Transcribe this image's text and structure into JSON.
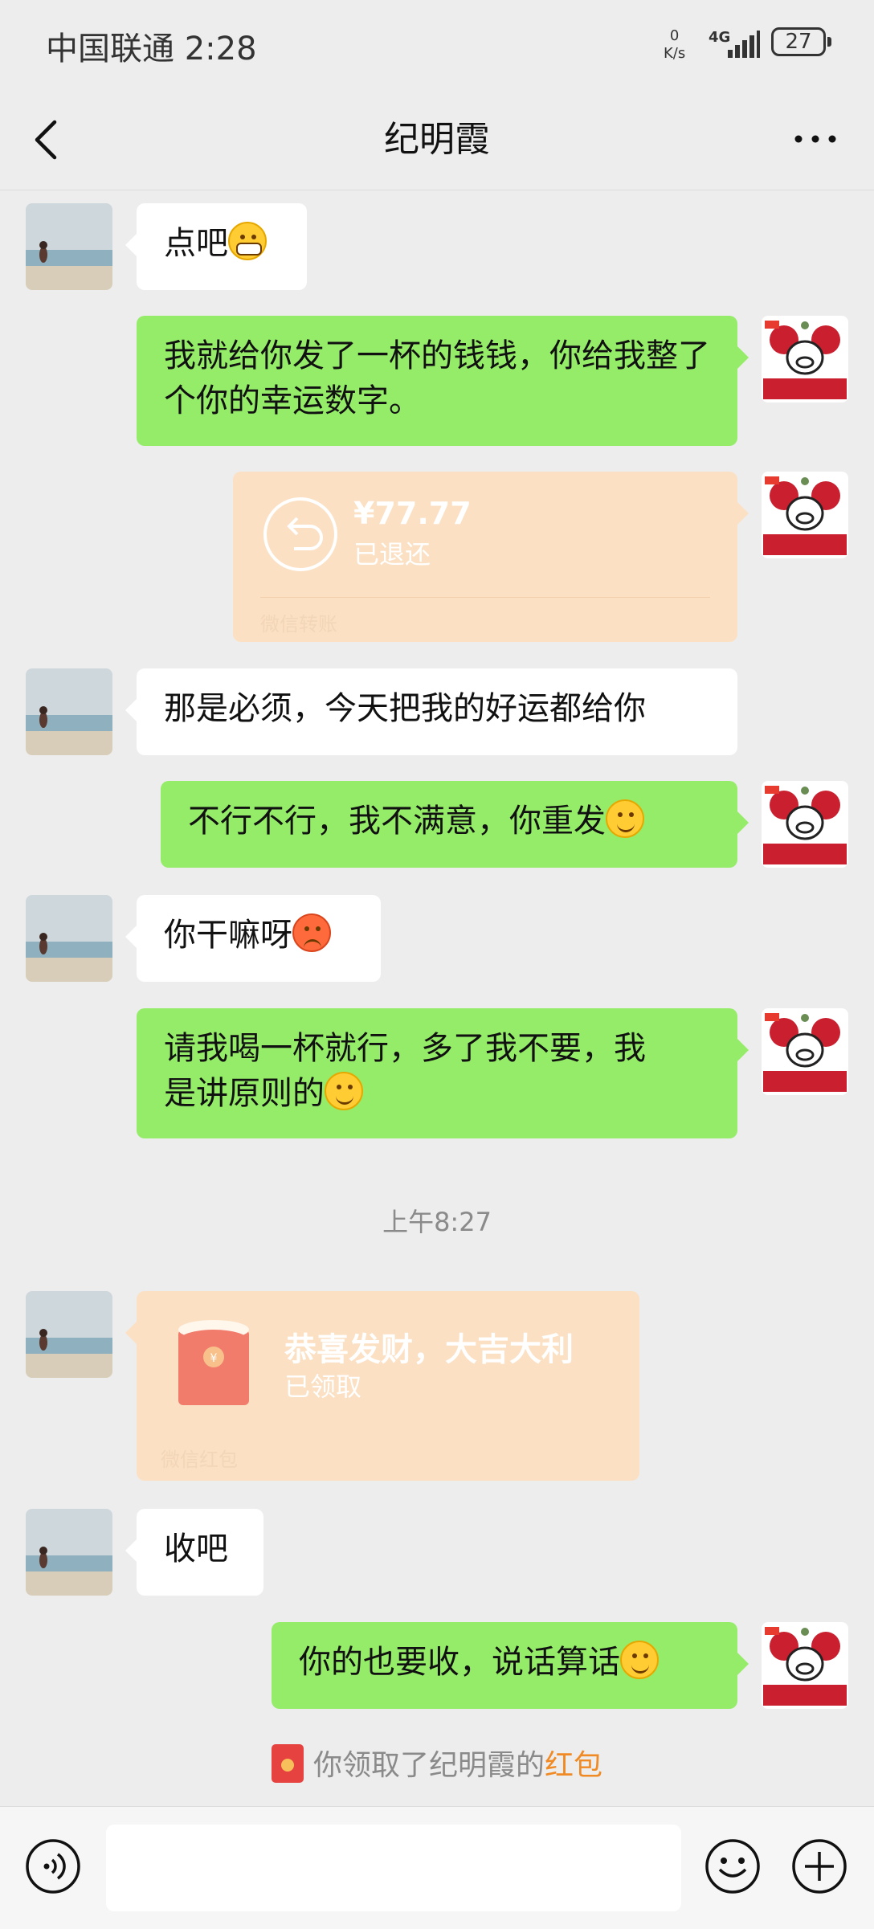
{
  "status_bar": {
    "carrier": "中国联通 2:28",
    "net_speed_value": "0",
    "net_speed_unit": "K/s",
    "network": "4G",
    "battery": "27"
  },
  "header": {
    "title": "纪明霞"
  },
  "messages": [
    {
      "side": "left",
      "text": "点吧",
      "emoji": "grinning-face"
    },
    {
      "side": "right",
      "text": "我就给你发了一杯的钱钱，你给我整了个你的幸运数字。"
    },
    {
      "side": "right",
      "type": "transfer",
      "amount": "¥77.77",
      "status": "已退还",
      "label": "微信转账"
    },
    {
      "side": "left",
      "text": "那是必须，今天把我的好运都给你"
    },
    {
      "side": "right",
      "text": "不行不行，我不满意，你重发",
      "emoji": "smiling-face"
    },
    {
      "side": "left",
      "text": "你干嘛呀",
      "emoji": "sweat-angry-face"
    },
    {
      "side": "right",
      "text_line1": "请我喝一杯就行，多了我不要，我",
      "text_line2": "是讲原则的",
      "emoji": "smiling-face"
    },
    {
      "side": "left",
      "type": "red-packet",
      "title": "恭喜发财，大吉大利",
      "status": "已领取",
      "label": "微信红包"
    },
    {
      "side": "left",
      "text": "收吧"
    },
    {
      "side": "right",
      "text": "你的也要收，说话算话",
      "emoji": "smiling-face"
    }
  ],
  "timestamp": "上午8:27",
  "system_message": {
    "prefix": "你领取了纪明霞的",
    "highlight": "红包"
  },
  "colors": {
    "background": "#ededed",
    "bubble_green": "#95ec69",
    "bubble_white": "#ffffff",
    "card_orange": "#fbe0c3",
    "highlight": "#f08a24"
  }
}
